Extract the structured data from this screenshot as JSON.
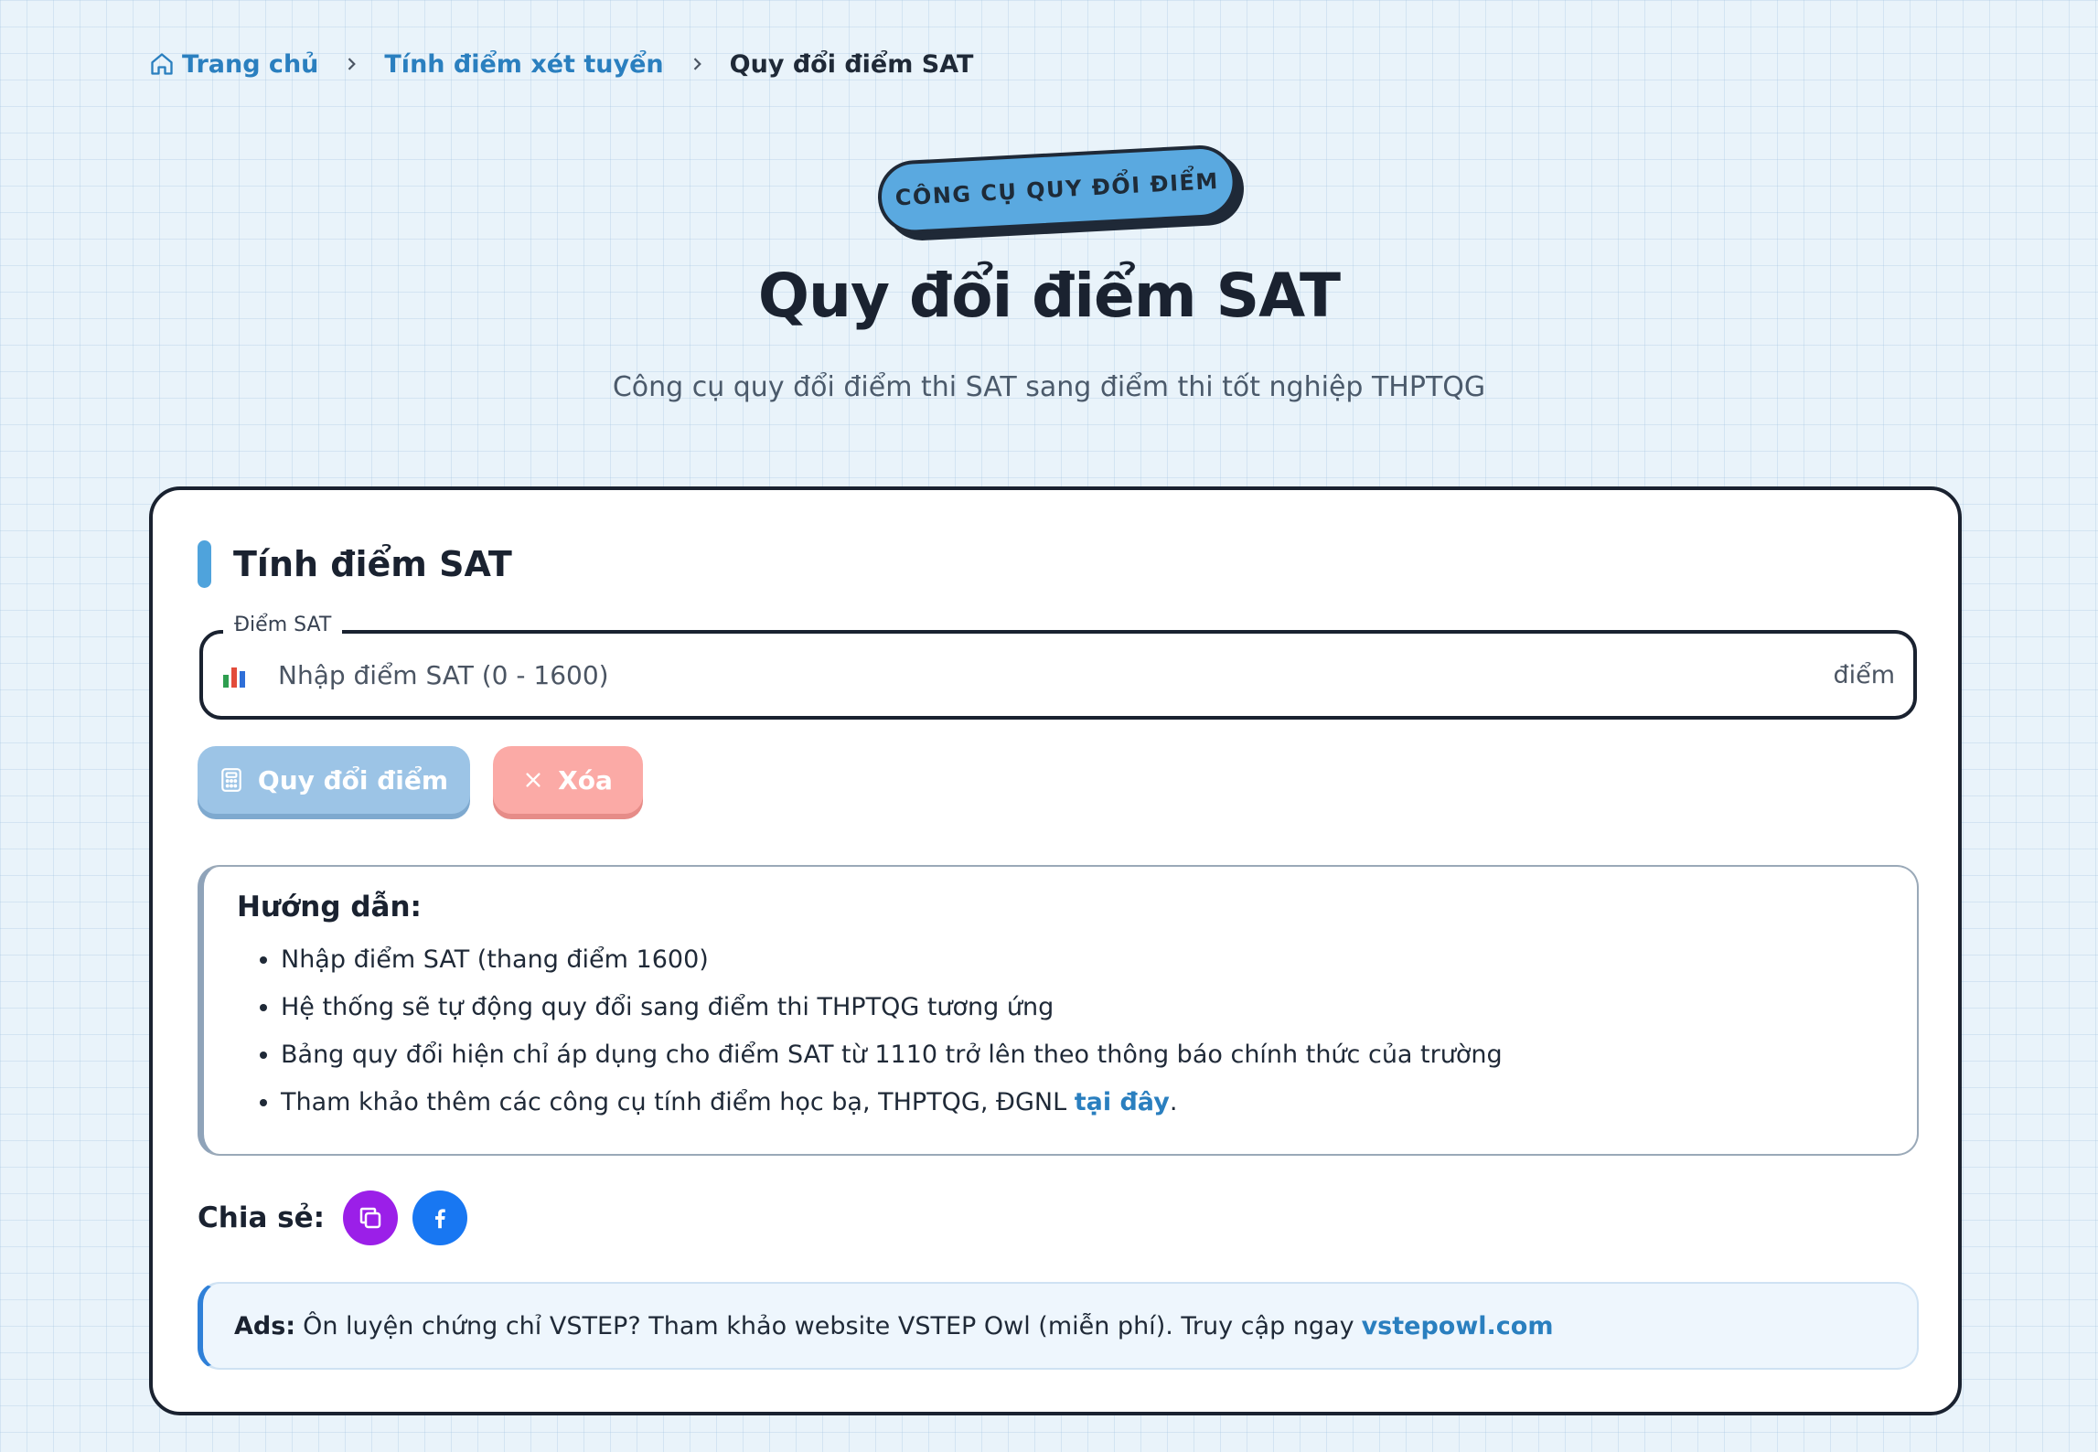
{
  "breadcrumb": {
    "home": "Trang chủ",
    "level2": "Tính điểm xét tuyển",
    "current": "Quy đổi điểm SAT"
  },
  "hero": {
    "badge": "CÔNG CỤ QUY ĐỔI ĐIỂM",
    "title": "Quy đổi điểm SAT",
    "subtitle": "Công cụ quy đổi điểm thi SAT sang điểm thi tốt nghiệp THPTQG"
  },
  "calculator": {
    "section_title": "Tính điểm SAT",
    "field_label": "Điểm SAT",
    "field_placeholder": "Nhập điểm SAT (0 - 1600)",
    "field_value": "",
    "field_unit": "điểm",
    "field_icon": "bar-chart-icon",
    "convert_label": "Quy đổi điểm",
    "clear_label": "Xóa"
  },
  "guide": {
    "title": "Hướng dẫn:",
    "items": [
      "Nhập điểm SAT (thang điểm 1600)",
      "Hệ thống sẽ tự động quy đổi sang điểm thi THPTQG tương ứng",
      "Bảng quy đổi hiện chỉ áp dụng cho điểm SAT từ 1110 trở lên theo thông báo chính thức của trường"
    ],
    "item4_text": "Tham khảo thêm các công cụ tính điểm học bạ, THPTQG, ĐGNL",
    "item4_link": "tại đây",
    "item4_end": "."
  },
  "share": {
    "label": "Chia sẻ:",
    "copy_icon": "copy-icon",
    "facebook_icon": "facebook-icon"
  },
  "ads": {
    "label": "Ads:",
    "text": "Ôn luyện chứng chỉ VSTEP? Tham khảo website VSTEP Owl (miễn phí). Truy cập ngay",
    "link": "vstepowl.com"
  },
  "colors": {
    "primary": "#2a7fbf",
    "accent_blue": "#5aa9e0",
    "convert_button": "#9cc4e6",
    "clear_button": "#fbaaa6",
    "copy_share": "#9b1fe8",
    "facebook_share": "#1877f2",
    "dark": "#1a2230"
  }
}
